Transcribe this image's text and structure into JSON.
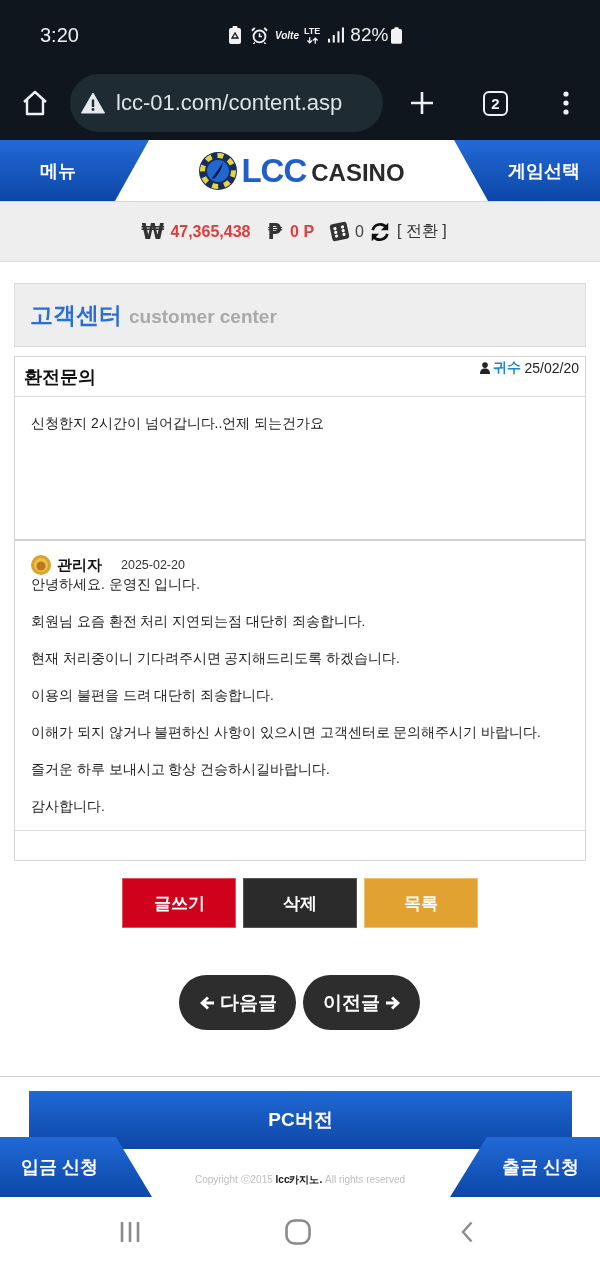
{
  "status_bar": {
    "time": "3:20",
    "volte": "Volte",
    "network": "LTE",
    "battery": "82%"
  },
  "browser": {
    "url": "lcc-01.com/content.asp",
    "tab_count": "2"
  },
  "header": {
    "menu": "메뉴",
    "logo_main": "LCC",
    "logo_sub": "CASINO",
    "game_select": "게임선택"
  },
  "balance": {
    "currency_symbol": "₩",
    "money": "47,365,438",
    "point_symbol": "₱",
    "points": "0 P",
    "chips": "0",
    "convert": "[ 전환 ]"
  },
  "section": {
    "title": "고객센터",
    "subtitle": "customer center"
  },
  "post": {
    "title": "환전문의",
    "author": "귀수",
    "date": "25/02/20",
    "body": "신청한지 2시간이 넘어갑니다..언제 되는건가요"
  },
  "reply": {
    "author": "관리자",
    "date": "2025-02-20",
    "paragraphs": [
      "안녕하세요. 운영진 입니다.",
      "회원님 요즘 환전 처리 지연되는점 대단히 죄송합니다.",
      "현재 처리중이니 기다려주시면 공지해드리도록 하겠습니다.",
      "이용의 불편을 드려 대단히 죄송합니다.",
      "이해가 되지 않거나 불편하신 사항이 있으시면 고객센터로 문의해주시기 바랍니다.",
      "즐거운 하루 보내시고 항상 건승하시길바랍니다.",
      "감사합니다."
    ]
  },
  "actions": [
    {
      "kind": "write",
      "label": "글쓰기"
    },
    {
      "kind": "delete",
      "label": "삭제"
    },
    {
      "kind": "list",
      "label": "목록"
    }
  ],
  "pager": [
    {
      "kind": "next",
      "label": "다음글"
    },
    {
      "kind": "previous",
      "label": "이전글"
    }
  ],
  "footer": {
    "pc_version": "PC버전",
    "deposit": "입금 신청",
    "withdraw": "출금 신청",
    "copyright": "Copyright ⓒ2015 **lcc카지노.** All rights reserved"
  }
}
